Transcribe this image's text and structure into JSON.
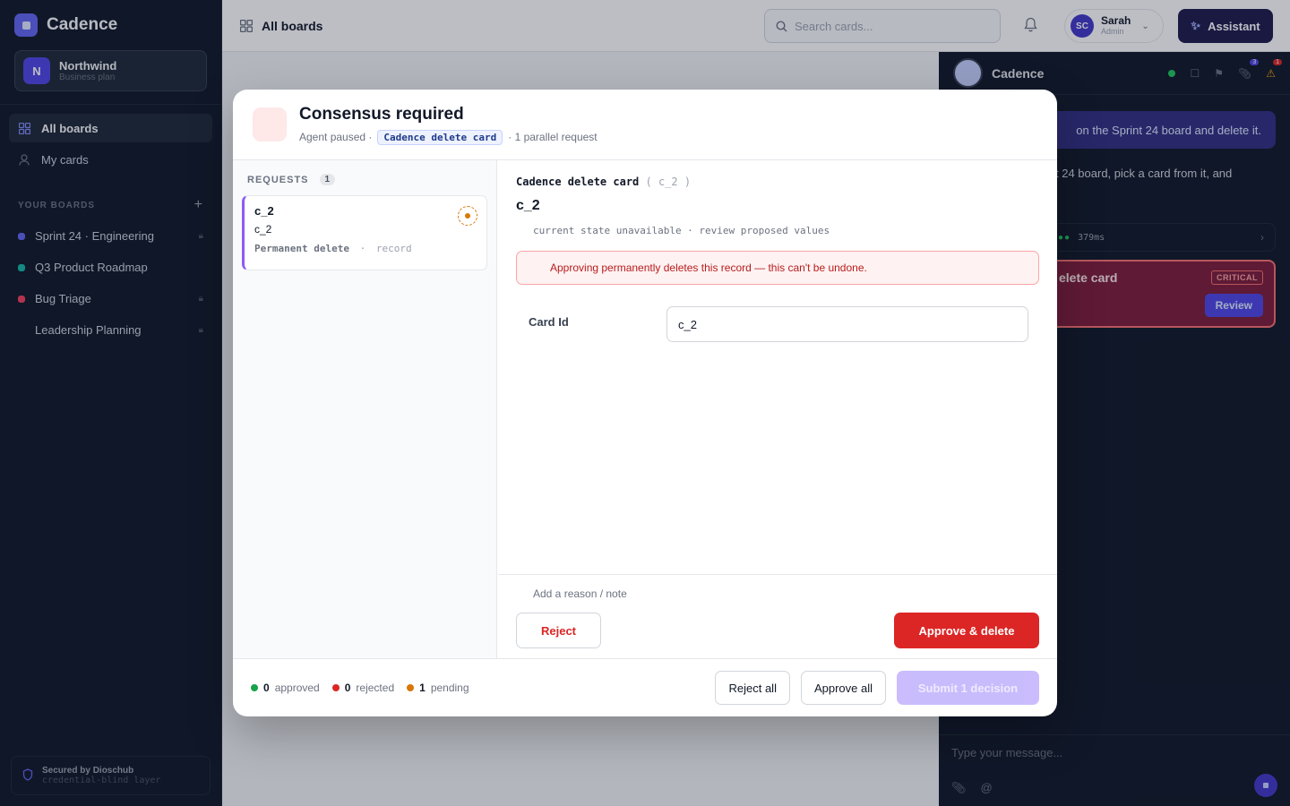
{
  "app": {
    "name": "Cadence"
  },
  "workspace": {
    "initial": "N",
    "name": "Northwind",
    "plan": "Business plan"
  },
  "nav": [
    {
      "label": "All boards",
      "icon": "grid-icon",
      "active": true
    },
    {
      "label": "My cards",
      "icon": "user-icon",
      "active": false
    }
  ],
  "boards_section": {
    "title": "YOUR BOARDS"
  },
  "boards": [
    {
      "label": "Sprint 24 · Engineering",
      "color": "#6366f1",
      "locked": true
    },
    {
      "label": "Q3 Product Roadmap",
      "color": "#14b8a6",
      "locked": false
    },
    {
      "label": "Bug Triage",
      "color": "#f43f5e",
      "locked": true
    },
    {
      "label": "Leadership Planning",
      "color": "",
      "locked": true
    }
  ],
  "secured": {
    "title": "Secured by Dioschub",
    "subtitle": "credential-blind layer"
  },
  "topbar": {
    "breadcrumb": "All boards",
    "search_placeholder": "Search cards...",
    "user": {
      "initials": "SC",
      "name": "Sarah",
      "role": "Admin"
    },
    "assistant_label": "Assistant"
  },
  "chat": {
    "title": "Cadence",
    "badges": {
      "attachments": "3",
      "alerts": "1"
    },
    "msg_user": "on the Sprint 24 board and delete it.",
    "msg_agent": "t 24 board, pick a card from it, and",
    "tool_time": "379ms",
    "alert_title": "elete card",
    "alert_badge": "CRITICAL",
    "review_label": "Review",
    "input_placeholder": "Type your message..."
  },
  "modal": {
    "title": "Consensus required",
    "sub_prefix": "Agent paused ·",
    "tool_pill": "Cadence delete card",
    "sub_suffix": "· 1 parallel request",
    "requests_label": "REQUESTS",
    "requests_count": "1",
    "request": {
      "title": "c_2",
      "subtitle": "c_2",
      "action": "Permanent delete",
      "kind": "record"
    },
    "detail": {
      "tool": "Cadence delete card",
      "tool_arg": "c_2",
      "title": "c_2",
      "state_note": "current state unavailable · review proposed values",
      "danger": "Approving permanently deletes this record — this can't be undone.",
      "field_label": "Card Id",
      "field_value": "c_2",
      "note_placeholder": "Add a reason / note",
      "reject_label": "Reject",
      "approve_label": "Approve & delete"
    },
    "footer": {
      "approved": "0",
      "approved_label": "approved",
      "rejected": "0",
      "rejected_label": "rejected",
      "pending": "1",
      "pending_label": "pending",
      "reject_all": "Reject all",
      "approve_all": "Approve all",
      "submit": "Submit 1 decision"
    }
  }
}
